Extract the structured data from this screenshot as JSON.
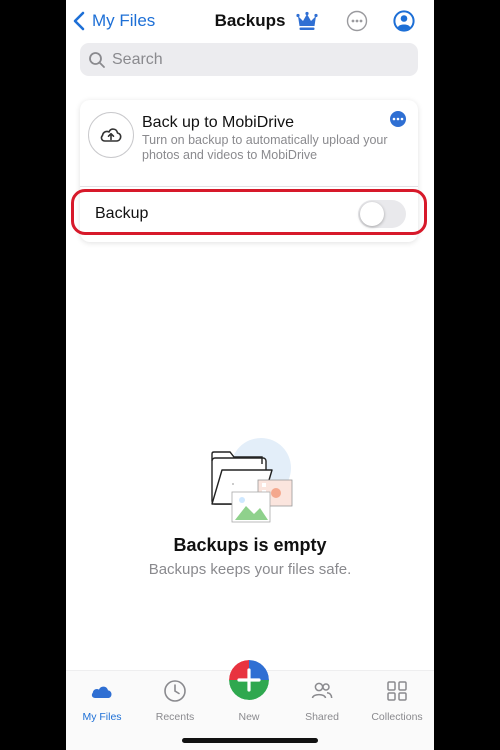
{
  "nav": {
    "back_label": "My Files",
    "title": "Backups"
  },
  "search": {
    "placeholder": "Search"
  },
  "backup_card": {
    "title": "Back up to MobiDrive",
    "description": "Turn on backup to automatically upload your photos and videos to MobiDrive",
    "toggle_label": "Backup",
    "toggle_on": false
  },
  "empty_state": {
    "title": "Backups is empty",
    "subtitle": "Backups keeps your files safe."
  },
  "tabs": [
    {
      "label": "My Files",
      "icon": "cloud-icon",
      "active": true
    },
    {
      "label": "Recents",
      "icon": "clock-icon",
      "active": false
    },
    {
      "label": "New",
      "icon": "plus-icon",
      "active": false
    },
    {
      "label": "Shared",
      "icon": "people-icon",
      "active": false
    },
    {
      "label": "Collections",
      "icon": "grid-icon",
      "active": false
    }
  ],
  "colors": {
    "accent": "#1d6fd6",
    "highlight": "#d7192a"
  }
}
